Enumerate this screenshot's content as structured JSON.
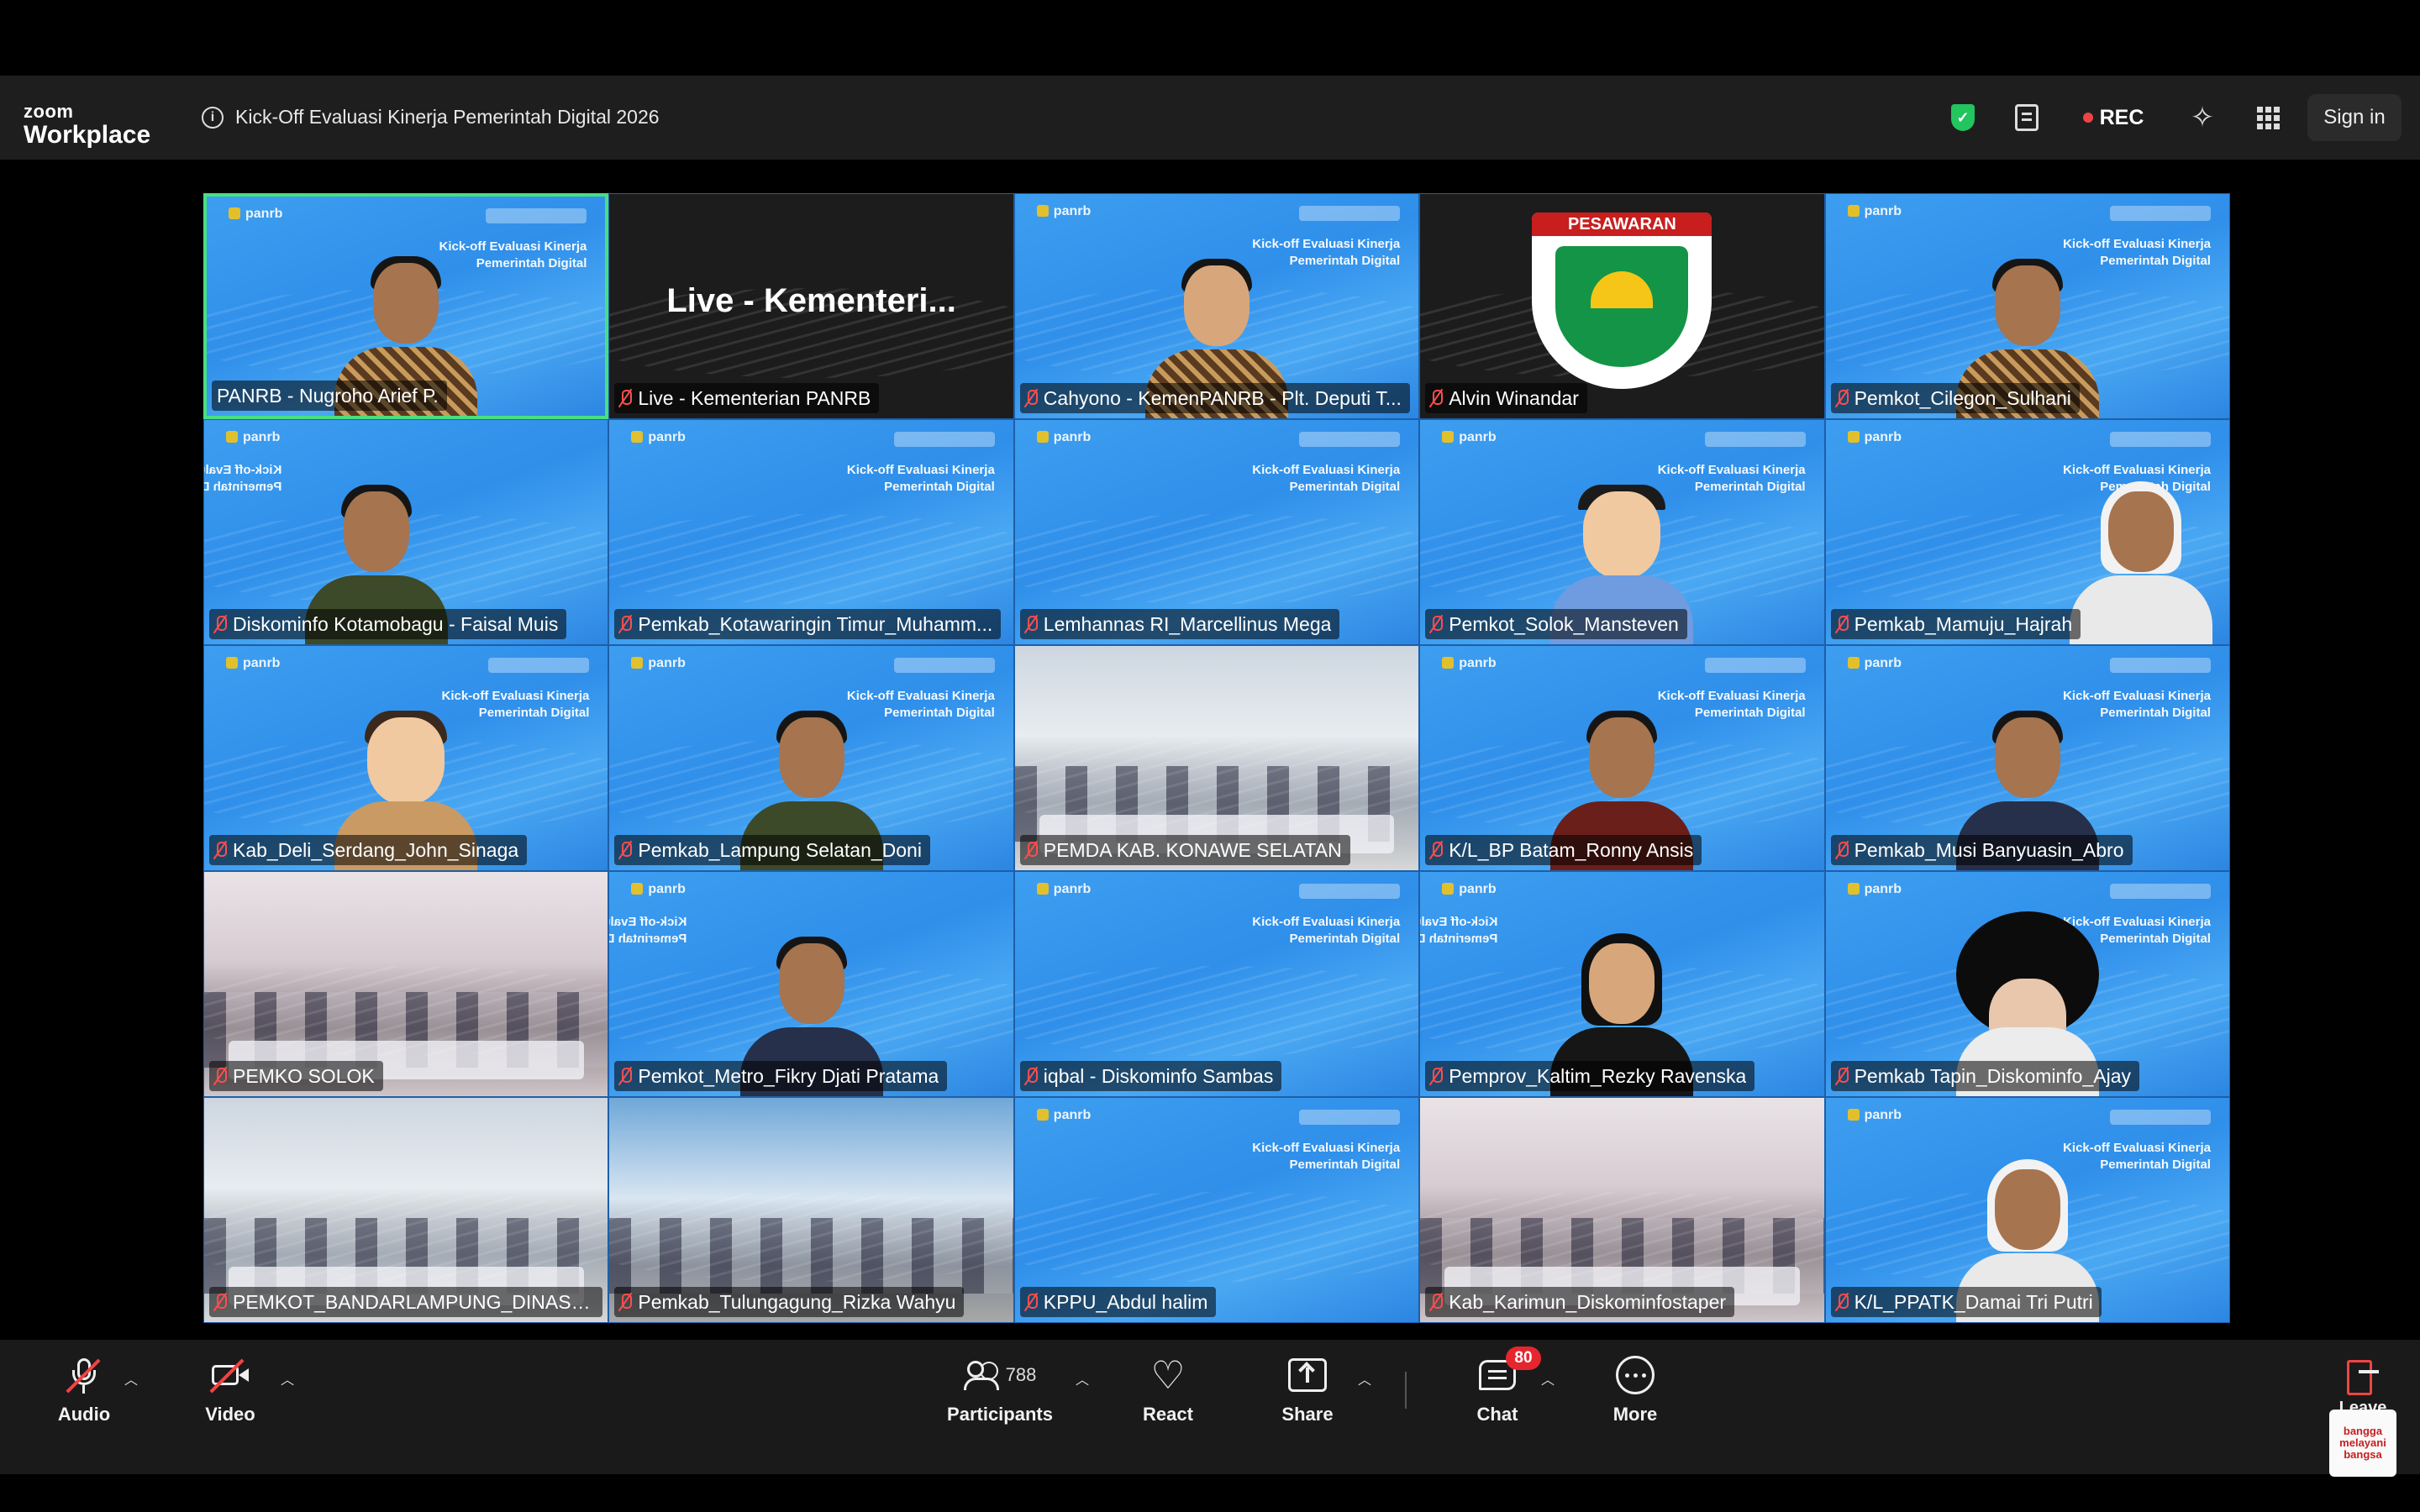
{
  "app": {
    "logo_line1": "zoom",
    "logo_line2": "Workplace",
    "meeting_title": "Kick-Off Evaluasi Kinerja Pemerintah Digital 2026",
    "rec_label": "REC",
    "sign_in_label": "Sign in"
  },
  "slide": {
    "brand": "panrb",
    "banner_line1": "Kick-off Evaluasi Kinerja",
    "banner_line2": "Pemerintah Digital"
  },
  "live_tile_text": "Live - Kementeri...",
  "logo_card_text": "PESAWARAN",
  "participants_grid": [
    {
      "name": "PANRB - Nugroho Arief P."
    },
    {
      "name": "Live - Kementerian PANRB"
    },
    {
      "name": "Cahyono - KemenPANRB - Plt. Deputi T..."
    },
    {
      "name": "Alvin Winandar"
    },
    {
      "name": "Pemkot_Cilegon_Sulhani"
    },
    {
      "name": "Diskominfo Kotamobagu - Faisal Muis"
    },
    {
      "name": "Pemkab_Kotawaringin Timur_Muhamm..."
    },
    {
      "name": "Lemhannas RI_Marcellinus Mega"
    },
    {
      "name": "Pemkot_Solok_Mansteven"
    },
    {
      "name": "Pemkab_Mamuju_Hajrah"
    },
    {
      "name": "Kab_Deli_Serdang_John_Sinaga"
    },
    {
      "name": "Pemkab_Lampung Selatan_Doni"
    },
    {
      "name": "PEMDA KAB. KONAWE SELATAN"
    },
    {
      "name": "K/L_BP Batam_Ronny Ansis"
    },
    {
      "name": "Pemkab_Musi Banyuasin_Abro"
    },
    {
      "name": "PEMKO SOLOK"
    },
    {
      "name": "Pemkot_Metro_Fikry Djati Pratama"
    },
    {
      "name": "iqbal - Diskominfo Sambas"
    },
    {
      "name": "Pemprov_Kaltim_Rezky Ravenska"
    },
    {
      "name": "Pemkab Tapin_Diskominfo_Ajay"
    },
    {
      "name": "PEMKOT_BANDARLAMPUNG_DINASKO..."
    },
    {
      "name": "Pemkab_Tulungagung_Rizka Wahyu"
    },
    {
      "name": "KPPU_Abdul halim"
    },
    {
      "name": "Kab_Karimun_Diskominfostaper"
    },
    {
      "name": "K/L_PPATK_Damai Tri Putri"
    }
  ],
  "toolbar": {
    "audio_label": "Audio",
    "video_label": "Video",
    "participants_label": "Participants",
    "participants_count": "788",
    "react_label": "React",
    "share_label": "Share",
    "chat_label": "Chat",
    "chat_badge": "80",
    "more_label": "More",
    "leave_label": "Leave",
    "watermark_line1": "bangga",
    "watermark_line2": "melayani",
    "watermark_line3": "bangsa"
  },
  "colors": {
    "active_speaker_border": "#4ade80",
    "muted_mic": "#ef4444",
    "chat_badge": "#e5262f",
    "slide_blue": "#2f8fea"
  },
  "icons": {
    "security": "shield-icon",
    "notes": "notes-icon",
    "ai": "sparkle-icon",
    "apps": "apps-grid-icon"
  }
}
